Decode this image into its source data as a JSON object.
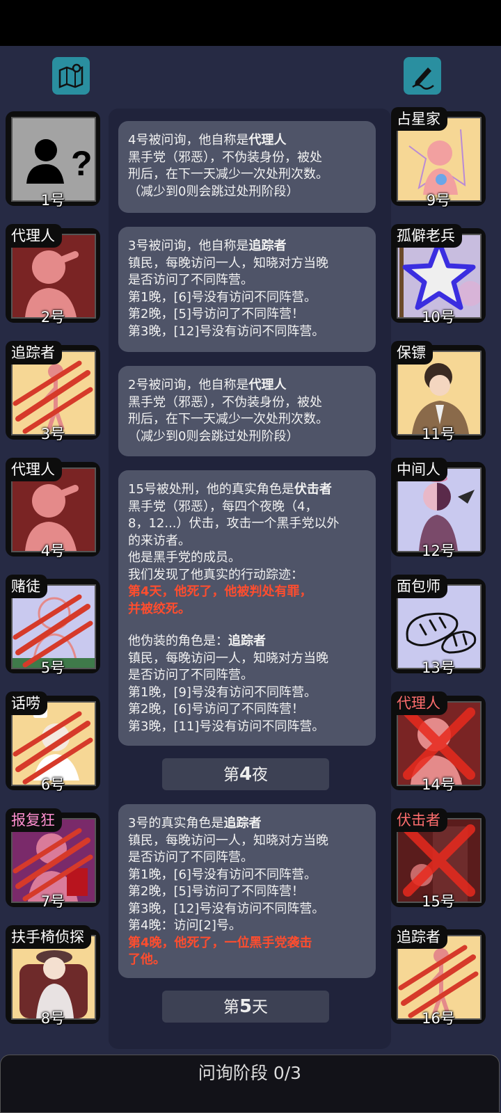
{
  "toolbar": {
    "map_icon": "map-pin-icon",
    "notes_icon": "pen-icon"
  },
  "players": [
    {
      "number": "1号",
      "role": "",
      "status": "unknown"
    },
    {
      "number": "2号",
      "role": "代理人",
      "status": "alive"
    },
    {
      "number": "3号",
      "role": "追踪者",
      "status": "dead"
    },
    {
      "number": "4号",
      "role": "代理人",
      "status": "alive"
    },
    {
      "number": "5号",
      "role": "赌徒",
      "status": "dead"
    },
    {
      "number": "6号",
      "role": "话唠",
      "status": "dead"
    },
    {
      "number": "7号",
      "role": "报复狂",
      "status": "dead"
    },
    {
      "number": "8号",
      "role": "扶手椅侦探",
      "status": "alive"
    },
    {
      "number": "9号",
      "role": "占星家",
      "status": "alive"
    },
    {
      "number": "10号",
      "role": "孤僻老兵",
      "status": "alive"
    },
    {
      "number": "11号",
      "role": "保镖",
      "status": "alive"
    },
    {
      "number": "12号",
      "role": "中间人",
      "status": "alive"
    },
    {
      "number": "13号",
      "role": "面包师",
      "status": "alive"
    },
    {
      "number": "14号",
      "role": "代理人",
      "status": "executed"
    },
    {
      "number": "15号",
      "role": "伏击者",
      "status": "executed"
    },
    {
      "number": "16号",
      "role": "追踪者",
      "status": "dead"
    }
  ],
  "log": {
    "m1": {
      "l1a": "4号被问询，他自称是",
      "l1b": "代理人",
      "l2": "黑手党（邪恶），不伪装身份，被处",
      "l3": "刑后，在下一天减少一次处刑次数。",
      "l4": "（减少到0则会跳过处刑阶段）"
    },
    "m2": {
      "l1a": "3号被问询，他自称是",
      "l1b": "追踪者",
      "l2": "镇民，每晚访问一人，知晓对方当晚",
      "l3": "是否访问了不同阵营。",
      "l4": "第1晚，[6]号没有访问不同阵营。",
      "l5": "第2晚，[5]号访问了不同阵营！",
      "l6": "第3晚，[12]号没有访问不同阵营。"
    },
    "m3": {
      "l1a": "2号被问询，他自称是",
      "l1b": "代理人",
      "l2": "黑手党（邪恶），不伪装身份，被处",
      "l3": "刑后，在下一天减少一次处刑次数。",
      "l4": "（减少到0则会跳过处刑阶段）"
    },
    "m4": {
      "l1a": "15号被处刑，他的真实角色是",
      "l1b": "伏击者",
      "l2": "黑手党（邪恶），每四个夜晚（4，",
      "l3": "8，12...）伏击，攻击一个黑手党以外",
      "l4": "的来访者。",
      "l5": "他是黑手党的成员。",
      "l6": "我们发现了他真实的行动踪迹：",
      "l7": "第4天，他死了，他被判处有罪，",
      "l8": "并被绞死。",
      "l9a": "他伪装的角色是：",
      "l9b": "追踪者",
      "l10": "镇民，每晚访问一人，知晓对方当晚",
      "l11": "是否访问了不同阵营。",
      "l12": "第1晚，[9]号没有访问不同阵营。",
      "l13": "第2晚，[6]号访问了不同阵营！",
      "l14": "第3晚，[11]号没有访问不同阵营。"
    },
    "phase_night": {
      "pre": "第",
      "num": "4",
      "post": "夜"
    },
    "m5": {
      "l1a": "3号的真实角色是",
      "l1b": "追踪者",
      "l2": "镇民，每晚访问一人，知晓对方当晚",
      "l3": "是否访问了不同阵营。",
      "l4": "第1晚，[6]号没有访问不同阵营。",
      "l5": "第2晚，[5]号访问了不同阵营！",
      "l6": "第3晚，[12]号没有访问不同阵营。",
      "l7": "第4晚：访问[2]号。",
      "l8": "第4晚，他死了，一位黑手党袭击",
      "l9": "了他。"
    },
    "phase_day": {
      "pre": "第",
      "num": "5",
      "post": "天"
    }
  },
  "bottom": {
    "label": "问询阶段 0/3"
  },
  "colors": {
    "background": "#262a44",
    "message_bg": "#4f5468",
    "highlight": "#ff4d2e",
    "icon_button": "#2a8fa0"
  }
}
